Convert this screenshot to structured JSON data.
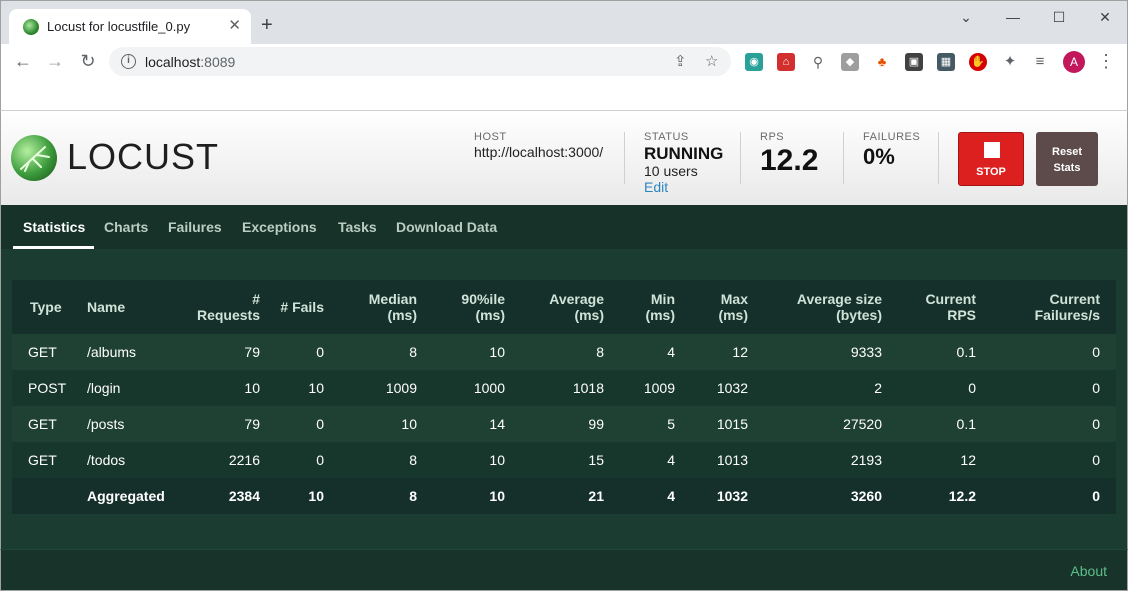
{
  "browser": {
    "tab_title": "Locust for locustfile_0.py",
    "url_host": "localhost",
    "url_port": ":8089",
    "avatar_letter": "A"
  },
  "header": {
    "logo_text": "LOCUST",
    "host_label": "HOST",
    "host_value": "http://localhost:3000/",
    "status_label": "STATUS",
    "status_value": "RUNNING",
    "users_value": "10 users",
    "edit_label": "Edit",
    "rps_label": "RPS",
    "rps_value": "12.2",
    "failures_label": "FAILURES",
    "failures_value": "0%",
    "stop_label": "STOP",
    "reset_label_1": "Reset",
    "reset_label_2": "Stats"
  },
  "nav": {
    "items": [
      {
        "label": "Statistics",
        "active": true
      },
      {
        "label": "Charts"
      },
      {
        "label": "Failures"
      },
      {
        "label": "Exceptions"
      },
      {
        "label": "Tasks"
      },
      {
        "label": "Download Data"
      }
    ]
  },
  "table": {
    "headers": [
      {
        "l1": "Type",
        "l2": ""
      },
      {
        "l1": "Name",
        "l2": ""
      },
      {
        "l1": "# Requests",
        "l2": ""
      },
      {
        "l1": "# Fails",
        "l2": ""
      },
      {
        "l1": "Median",
        "l2": "(ms)"
      },
      {
        "l1": "90%ile",
        "l2": "(ms)"
      },
      {
        "l1": "Average",
        "l2": "(ms)"
      },
      {
        "l1": "Min",
        "l2": "(ms)"
      },
      {
        "l1": "Max",
        "l2": "(ms)"
      },
      {
        "l1": "Average size",
        "l2": "(bytes)"
      },
      {
        "l1": "Current",
        "l2": "RPS"
      },
      {
        "l1": "Current",
        "l2": "Failures/s"
      }
    ],
    "rows": [
      [
        "GET",
        "/albums",
        "79",
        "0",
        "8",
        "10",
        "8",
        "4",
        "12",
        "9333",
        "0.1",
        "0"
      ],
      [
        "POST",
        "/login",
        "10",
        "10",
        "1009",
        "1000",
        "1018",
        "1009",
        "1032",
        "2",
        "0",
        "0"
      ],
      [
        "GET",
        "/posts",
        "79",
        "0",
        "10",
        "14",
        "99",
        "5",
        "1015",
        "27520",
        "0.1",
        "0"
      ],
      [
        "GET",
        "/todos",
        "2216",
        "0",
        "8",
        "10",
        "15",
        "4",
        "1013",
        "2193",
        "12",
        "0"
      ]
    ],
    "aggregate": [
      "",
      "Aggregated",
      "2384",
      "10",
      "8",
      "10",
      "21",
      "4",
      "1032",
      "3260",
      "12.2",
      "0"
    ]
  },
  "footer": {
    "about_label": "About"
  }
}
